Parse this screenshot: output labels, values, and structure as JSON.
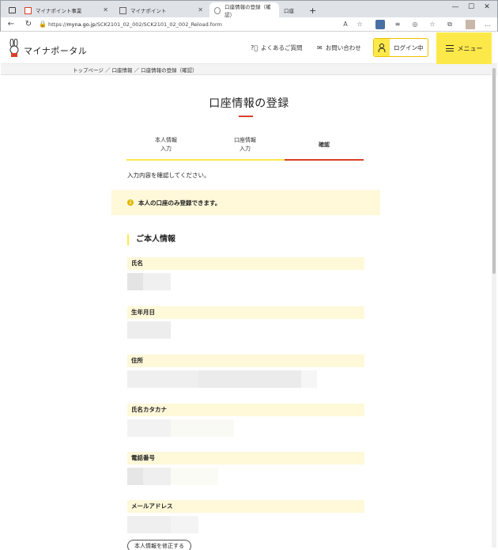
{
  "browser": {
    "tabs": [
      {
        "label": "マイナポイント事業",
        "active": false
      },
      {
        "label": "マイナポイント",
        "active": false
      },
      {
        "label": "口座情報の登録（確認）",
        "active": true
      },
      {
        "label": "口座",
        "active": false
      }
    ],
    "new_tab": "+",
    "url_prefix": "https://",
    "url_domain": "myna.go.jp",
    "url_path": "/SCK2101_02_002/SCK2101_02_002_Reload.form"
  },
  "header": {
    "logo_text": "マイナポータル",
    "faq": "よくあるご質問",
    "contact": "お問い合わせ",
    "login": "ログイン中",
    "menu": "メニュー"
  },
  "breadcrumb": "トップページ ／ 口座情報 ／ 口座情報の登録（確認）",
  "page": {
    "title": "口座情報の登録",
    "steps": [
      {
        "line1": "本人情報",
        "line2": "入力"
      },
      {
        "line1": "口座情報",
        "line2": "入力"
      },
      {
        "line1": "確認",
        "line2": ""
      }
    ],
    "instruction": "入力内容を確認してください。",
    "notice": "本人の口座のみ登録できます。",
    "section_title": "ご本人情報",
    "fields": [
      {
        "label": "氏名"
      },
      {
        "label": "生年月日"
      },
      {
        "label": "住所"
      },
      {
        "label": "氏名カタカナ"
      },
      {
        "label": "電話番号"
      },
      {
        "label": "メールアドレス"
      }
    ],
    "edit_button": "本人情報を修正する"
  },
  "colors": {
    "accent_yellow": "#fde84a",
    "accent_red": "#d9402a",
    "notice_bg": "#fff8d9"
  }
}
